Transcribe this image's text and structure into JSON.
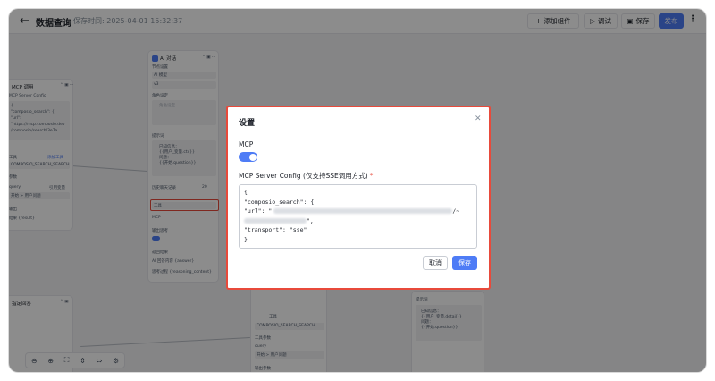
{
  "header": {
    "back_icon": "arrow-left-icon",
    "title": "数据查询",
    "save_time": "保存时间: 2025-04-01 15:32:37",
    "add_component": "添加组件",
    "debug": "调试",
    "save": "保存",
    "publish": "发布"
  },
  "canvas": {
    "mcp_node": {
      "title": "MCP 调用",
      "config_label": "MCP Server Config",
      "code_lines": [
        "{",
        "\"composio_search\": {",
        "\"url\":",
        "\"https://mcp.composio.dev",
        "/composio/search/3e7a..."
      ],
      "tool_label": "工具",
      "add_tool": "添加工具",
      "tool_value": "COMPOSIO_SEARCH_SEARCH",
      "param_label": "参数",
      "query_label": "query",
      "var_option": "引用变量",
      "var_value": "开始 > 用户问题",
      "output_label": "输出",
      "output_value": "结果 {result}"
    },
    "ai_node": {
      "title": "AI 对话",
      "node_settings": "节点设置",
      "model_label": "AI 模型",
      "model_value": "v3",
      "role_label": "角色设定",
      "role_placeholder": "角色设定",
      "prompt_label": "提示词",
      "prompt_lines": [
        "已知信息：",
        "{{用户_变量.ctx}}",
        "问题：",
        "{{开始.question}}"
      ],
      "history_label": "历史聊天记录",
      "history_value": "20",
      "tools_label": "工具",
      "mcp_label": "MCP",
      "output_label": "输出思考",
      "stream_label": "返回结果",
      "output_var_1": "AI 回答内容 {answer}",
      "output_var_2": "思考过程 {reasoning_content}"
    },
    "bottom_nodes": {
      "filter_title": "指定回答",
      "tool_label": "工具",
      "tool_value": "COMPOSIO_SEARCH_SEARCH",
      "params_label": "工具参数",
      "query_label": "query",
      "query_value": "开始 > 用户问题",
      "output_label": "输出参数",
      "right_title": "提示词",
      "right_lines": [
        "已知信息：",
        "{{用户_变量.detail}}",
        "问题：",
        "{{开始.question}}"
      ]
    },
    "zoom_icons": [
      "zoom-out-icon",
      "zoom-in-icon",
      "fit-view-icon",
      "align-icon",
      "layout-icon",
      "settings-icon"
    ]
  },
  "modal": {
    "title": "设置",
    "mcp_label": "MCP",
    "mcp_enabled": true,
    "config_label": "MCP Server Config (仅支持SSE调用方式)",
    "required_mark": "*",
    "config_lines": [
      "{",
      "\"composio_search\": {",
      "\"url\": \"",
      "\",",
      "\"transport\": \"sse\"",
      "}"
    ],
    "url_suffix": "/~",
    "cancel": "取消",
    "save": "保存"
  },
  "colors": {
    "accent": "#4e7cf6",
    "highlight": "#e84a3b"
  }
}
